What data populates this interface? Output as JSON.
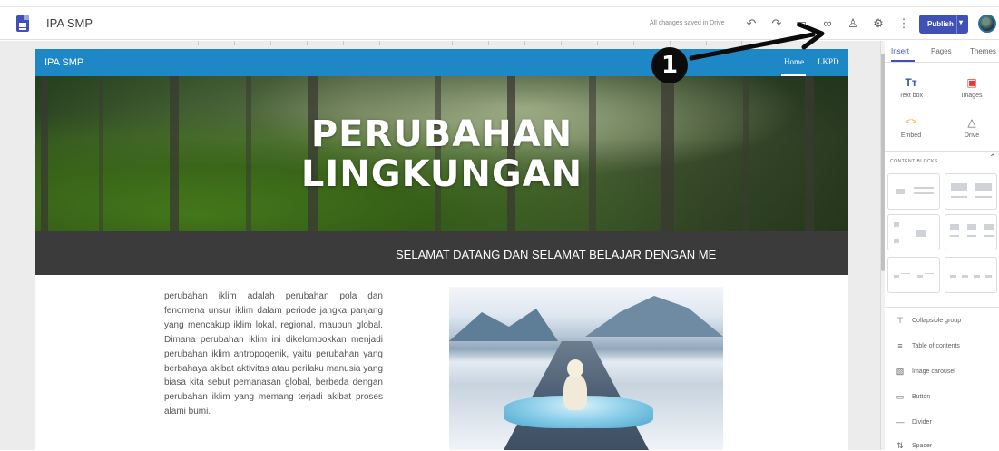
{
  "app": {
    "title": "IPA SMP",
    "save_status": "All changes saved in Drive",
    "publish_label": "Publish"
  },
  "toolbar": {
    "icons": [
      "undo-icon",
      "redo-icon",
      "preview-icon",
      "link-icon",
      "share-icon",
      "settings-icon",
      "more-icon"
    ]
  },
  "site": {
    "name": "IPA SMP",
    "nav": [
      {
        "label": "Home",
        "active": true
      },
      {
        "label": "LKPD",
        "active": false
      }
    ],
    "hero_title_line1": "PERUBAHAN",
    "hero_title_line2": "LINGKUNGAN",
    "banner_text": "SELAMAT DATANG DAN SELAMAT BELAJAR DENGAN ME",
    "body_paragraph": "perubahan iklim adalah perubahan pola dan fenomena unsur iklim dalam periode jangka panjang yang mencakup iklim lokal, regional, maupun global. Dimana perubahan iklim ini dikelompokkan menjadi perubahan iklim antropogenik, yaitu perubahan yang berbahaya akibat aktivitas atau perilaku manusia yang biasa kita sebut pemanasan global, berbeda dengan perubahan iklim yang memang terjadi akibat proses alami bumi."
  },
  "side_panel": {
    "tabs": [
      {
        "label": "Insert",
        "active": true
      },
      {
        "label": "Pages",
        "active": false
      },
      {
        "label": "Themes",
        "active": false
      }
    ],
    "insert_tools": [
      {
        "label": "Text box",
        "icon": "text-box-icon",
        "color": "#3f51b5"
      },
      {
        "label": "Images",
        "icon": "images-icon",
        "color": "#e53935"
      },
      {
        "label": "Embed",
        "icon": "embed-icon",
        "color": "#f9a825"
      },
      {
        "label": "Drive",
        "icon": "drive-icon",
        "color": "#5f6368"
      }
    ],
    "content_blocks_heading": "CONTENT BLOCKS",
    "components": [
      {
        "label": "Collapsible group",
        "icon": "collapsible-group-icon"
      },
      {
        "label": "Table of contents",
        "icon": "table-of-contents-icon"
      },
      {
        "label": "Image carousel",
        "icon": "image-carousel-icon"
      },
      {
        "label": "Button",
        "icon": "button-icon"
      },
      {
        "label": "Divider",
        "icon": "divider-icon"
      },
      {
        "label": "Spacer",
        "icon": "spacer-icon"
      }
    ]
  },
  "annotation": {
    "step_number": "1"
  },
  "colors": {
    "accent": "#3f51b5",
    "site_nav": "#1e88c6",
    "banner": "#3b3b3b"
  }
}
